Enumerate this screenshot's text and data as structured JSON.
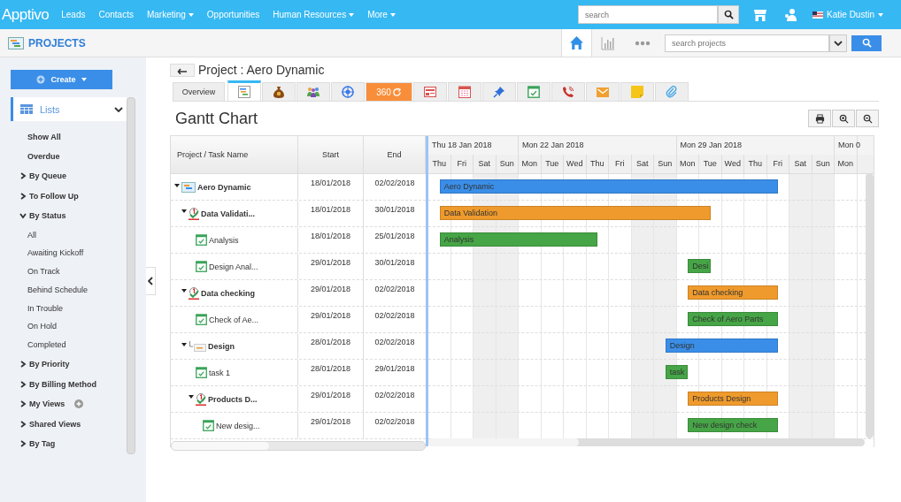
{
  "topbar": {
    "logo": "Apptivo",
    "nav": [
      {
        "label": "Leads",
        "dropdown": false
      },
      {
        "label": "Contacts",
        "dropdown": false
      },
      {
        "label": "Marketing",
        "dropdown": true
      },
      {
        "label": "Opportunities",
        "dropdown": false
      },
      {
        "label": "Human Resources",
        "dropdown": true
      },
      {
        "label": "More",
        "dropdown": true
      }
    ],
    "search": {
      "placeholder": "search"
    },
    "user": "Katie Dustin"
  },
  "appbar": {
    "title": "PROJECTS",
    "search": {
      "placeholder": "search projects"
    }
  },
  "sidebar": {
    "create": "Create",
    "lists": "Lists",
    "items": [
      {
        "label": "Show All",
        "kind": "link"
      },
      {
        "label": "Overdue",
        "kind": "link"
      },
      {
        "label": "By Queue",
        "kind": "group",
        "expanded": false
      },
      {
        "label": "To Follow Up",
        "kind": "group",
        "expanded": false
      },
      {
        "label": "By Status",
        "kind": "group",
        "expanded": true,
        "children": [
          {
            "label": "All"
          },
          {
            "label": "Awaiting Kickoff"
          },
          {
            "label": "On Track"
          },
          {
            "label": "Behind Schedule"
          },
          {
            "label": "In Trouble"
          },
          {
            "label": "On Hold"
          },
          {
            "label": "Completed"
          }
        ]
      },
      {
        "label": "By Priority",
        "kind": "group",
        "expanded": false
      },
      {
        "label": "By Billing Method",
        "kind": "group",
        "expanded": false
      },
      {
        "label": "My Views",
        "kind": "group-add",
        "expanded": false
      },
      {
        "label": "Shared Views",
        "kind": "group",
        "expanded": false
      },
      {
        "label": "By Tag",
        "kind": "group",
        "expanded": false
      }
    ]
  },
  "page": {
    "title": "Project : Aero Dynamic",
    "tabs": [
      {
        "kind": "text",
        "label": "Overview",
        "selected": false
      },
      {
        "kind": "gantt",
        "selected": true
      },
      {
        "kind": "money",
        "selected": false
      },
      {
        "kind": "people",
        "selected": false
      },
      {
        "kind": "target",
        "selected": false
      },
      {
        "kind": "accent",
        "label": "360",
        "selected": false
      },
      {
        "kind": "sheet",
        "selected": false
      },
      {
        "kind": "calendar",
        "selected": false
      },
      {
        "kind": "pin",
        "selected": false
      },
      {
        "kind": "task",
        "selected": false
      },
      {
        "kind": "phone",
        "selected": false
      },
      {
        "kind": "mail",
        "selected": false
      },
      {
        "kind": "note",
        "selected": false
      },
      {
        "kind": "clip",
        "selected": false
      }
    ],
    "heading": "Gantt Chart"
  },
  "gantt": {
    "columns": [
      "Project / Task Name",
      "Start",
      "End"
    ],
    "weeks": [
      {
        "label": "Thu 18 Jan 2018",
        "days": [
          {
            "label": "Thu",
            "weekend": false
          },
          {
            "label": "Fri",
            "weekend": false
          },
          {
            "label": "Sat",
            "weekend": true
          },
          {
            "label": "Sun",
            "weekend": true
          }
        ]
      },
      {
        "label": "Mon 22 Jan 2018",
        "days": [
          {
            "label": "Mon",
            "weekend": false
          },
          {
            "label": "Tue",
            "weekend": false
          },
          {
            "label": "Wed",
            "weekend": false
          },
          {
            "label": "Thu",
            "weekend": false
          },
          {
            "label": "Fri",
            "weekend": false
          },
          {
            "label": "Sat",
            "weekend": true
          },
          {
            "label": "Sun",
            "weekend": true
          }
        ]
      },
      {
        "label": "Mon 29 Jan 2018",
        "days": [
          {
            "label": "Mon",
            "weekend": false
          },
          {
            "label": "Tue",
            "weekend": false
          },
          {
            "label": "Wed",
            "weekend": false
          },
          {
            "label": "Thu",
            "weekend": false
          },
          {
            "label": "Fri",
            "weekend": false
          },
          {
            "label": "Sat",
            "weekend": true
          },
          {
            "label": "Sun",
            "weekend": true
          }
        ]
      },
      {
        "label": "Mon 0",
        "days": [
          {
            "label": "Mon",
            "weekend": false
          }
        ]
      }
    ],
    "rows": [
      {
        "name": "Aero Dynamic",
        "kind": "project",
        "start": "18/01/2018",
        "end": "02/02/2018",
        "bar": "Aero Dynamic",
        "color": "#3a8ee8",
        "expanded": true,
        "children": [
          {
            "name": "Data Validati...",
            "kind": "milestone",
            "start": "18/01/2018",
            "end": "30/01/2018",
            "bar": "Data Validation",
            "color": "#ef9a2c",
            "expanded": true,
            "children": [
              {
                "name": "Analysis",
                "kind": "task",
                "start": "18/01/2018",
                "end": "25/01/2018",
                "bar": "Analysis",
                "color": "#46a546"
              },
              {
                "name": "Design Anal...",
                "kind": "task",
                "start": "29/01/2018",
                "end": "30/01/2018",
                "bar": "Desi",
                "color": "#46a546"
              }
            ]
          },
          {
            "name": "Data checking",
            "kind": "milestone",
            "start": "29/01/2018",
            "end": "02/02/2018",
            "bar": "Data checking",
            "color": "#ef9a2c",
            "expanded": true,
            "children": [
              {
                "name": "Check of Ae...",
                "kind": "task",
                "start": "29/01/2018",
                "end": "02/02/2018",
                "bar": "Check of Aero Parts",
                "color": "#46a546"
              }
            ]
          },
          {
            "name": "Design",
            "kind": "subproject",
            "start": "28/01/2018",
            "end": "02/02/2018",
            "bar": "Design",
            "color": "#3a8ee8",
            "expanded": true,
            "children": [
              {
                "name": "task 1",
                "kind": "task",
                "start": "28/01/2018",
                "end": "29/01/2018",
                "bar": "task",
                "color": "#46a546"
              },
              {
                "name": "Products D...",
                "kind": "milestone",
                "start": "29/01/2018",
                "end": "02/02/2018",
                "bar": "Products Design",
                "color": "#ef9a2c",
                "expanded": true,
                "children": [
                  {
                    "name": "New desig...",
                    "kind": "task",
                    "start": "29/01/2018",
                    "end": "02/02/2018",
                    "bar": "New design check",
                    "color": "#46a546"
                  }
                ]
              }
            ]
          }
        ]
      }
    ]
  }
}
